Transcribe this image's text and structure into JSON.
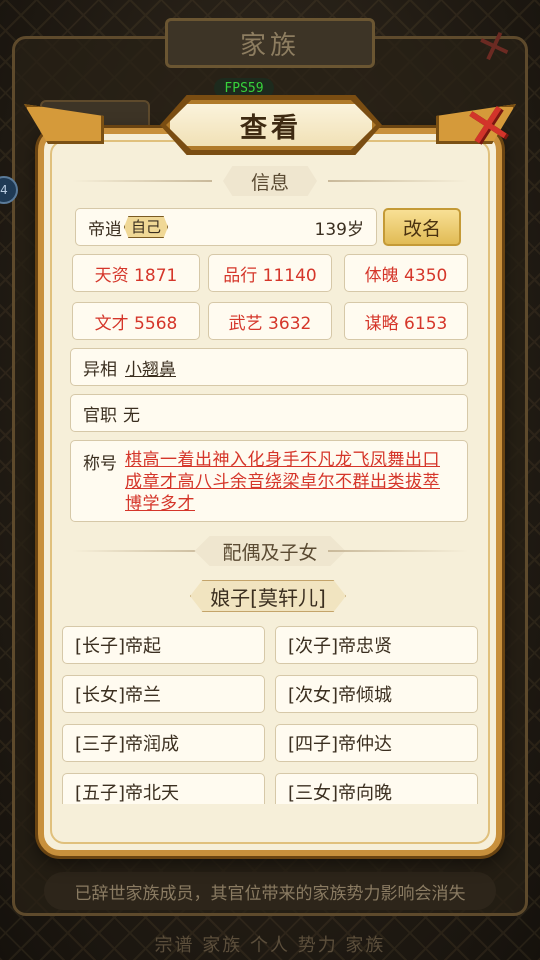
{
  "background": {
    "window_title": "家族",
    "notice": "已辞世家族成员，其官位带来的家族势力影响会消失",
    "bottom_text": "宗谱  家族  个人  势力  家族"
  },
  "fps": "FPS59",
  "side_bubble": "4",
  "dialog": {
    "title": "查看",
    "close_icon": "close-x-icon"
  },
  "info": {
    "section_title": "信息",
    "name": "帝逍",
    "self_tag": "自己",
    "age": "139岁",
    "rename_label": "改名",
    "stats": [
      {
        "label": "天资 1871"
      },
      {
        "label": "品行 11140"
      },
      {
        "label": "体魄 4350"
      },
      {
        "label": "文才 5568"
      },
      {
        "label": "武艺 3632"
      },
      {
        "label": "谋略 6153"
      }
    ],
    "appearance_label": "异相",
    "appearance_value": "小翘鼻",
    "office_label": "官职",
    "office_value": "无",
    "titles_label": "称号",
    "titles_value": "棋高一着出神入化身手不凡龙飞凤舞出口成章才高八斗余音绕梁卓尔不群出类拔萃博学多才"
  },
  "family": {
    "section_title": "配偶及子女",
    "spouse": "娘子[莫轩儿]",
    "children": [
      "[长子]帝起",
      "[次子]帝忠贤",
      "[长女]帝兰",
      "[次女]帝倾城",
      "[三子]帝润成",
      "[四子]帝仲达",
      "[五子]帝北天",
      "[三女]帝向晚"
    ]
  },
  "colors": {
    "accent_red": "#d5362a",
    "gold": "#c8903c",
    "panel": "#f6efd9"
  }
}
